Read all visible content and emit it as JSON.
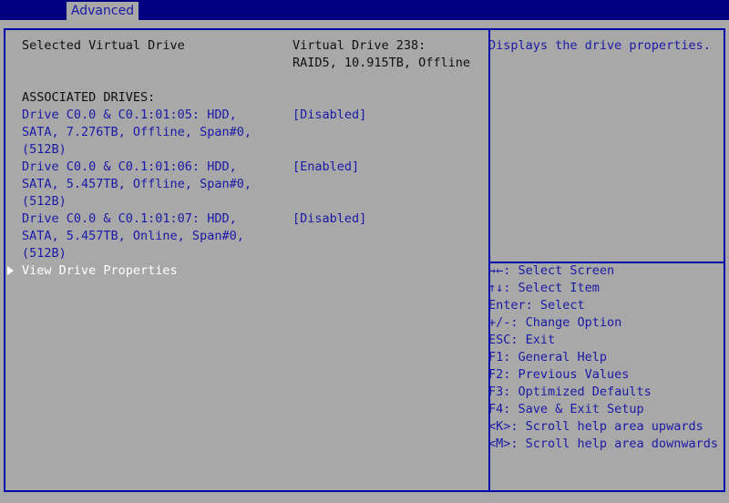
{
  "tabs": {
    "active": "Advanced"
  },
  "settings": {
    "selected_vd_label": "Selected Virtual Drive",
    "selected_vd_value_line1": "Virtual Drive 238:",
    "selected_vd_value_line2": "RAID5, 10.915TB, Offline",
    "associated_header": "ASSOCIATED DRIVES:",
    "drives": [
      {
        "line1": "Drive C0.0 & C0.1:01:05: HDD,",
        "line2": "SATA, 7.276TB, Offline, Span#0,",
        "line3": "(512B)",
        "state": "[Disabled]"
      },
      {
        "line1": "Drive C0.0 & C0.1:01:06: HDD,",
        "line2": "SATA, 5.457TB, Offline, Span#0,",
        "line3": "(512B)",
        "state": "[Enabled]"
      },
      {
        "line1": "Drive C0.0 & C0.1:01:07: HDD,",
        "line2": "SATA, 5.457TB, Online, Span#0,",
        "line3": "(512B)",
        "state": "[Disabled]"
      }
    ],
    "view_props": "View Drive Properties"
  },
  "help": {
    "text": "Displays the drive properties."
  },
  "keys": [
    "→←: Select Screen",
    "↑↓: Select Item",
    "Enter: Select",
    "+/-: Change Option",
    "ESC: Exit",
    "F1: General Help",
    "F2: Previous Values",
    "F3: Optimized Defaults",
    "F4: Save & Exit Setup",
    "<K>: Scroll help area upwards",
    "<M>: Scroll help area downwards"
  ],
  "colors": {
    "background": "#000080",
    "panel": "#a8a8a8",
    "accent_blue": "#1a1aa6",
    "highlight": "#ffffff"
  }
}
